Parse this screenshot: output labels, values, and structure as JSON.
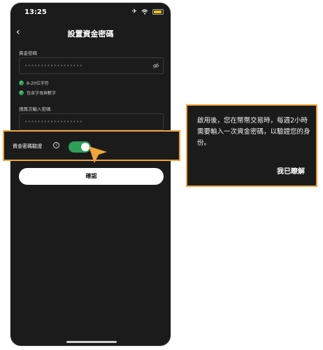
{
  "status_bar": {
    "time": "13:25"
  },
  "header": {
    "back_icon": "‹",
    "title": "設置資金密碼"
  },
  "password_field": {
    "label": "資金密碼",
    "masked_value": "••••••••••••••••••",
    "icon": "eye-off-icon"
  },
  "rules": [
    {
      "text": "8-20位字符",
      "status": "passed"
    },
    {
      "text": "包含字母與數字",
      "status": "passed"
    }
  ],
  "confirm_field": {
    "label": "請再次輸入密碼",
    "masked_value": "••••••••••••••••••"
  },
  "toggle": {
    "label": "資金密碼驗證",
    "info_icon": "i",
    "state": "on"
  },
  "confirm_button": {
    "label": "確認"
  },
  "tooltip": {
    "message": "啟用後，您在幣幣交易時，每週2小時需要輸入一次資金密碼，以驗證您的身份。",
    "ack_label": "我已瞭解"
  },
  "colors": {
    "accent_highlight": "#f2a43a",
    "toggle_on": "#2e9e5b",
    "background": "#1b1b1b"
  }
}
